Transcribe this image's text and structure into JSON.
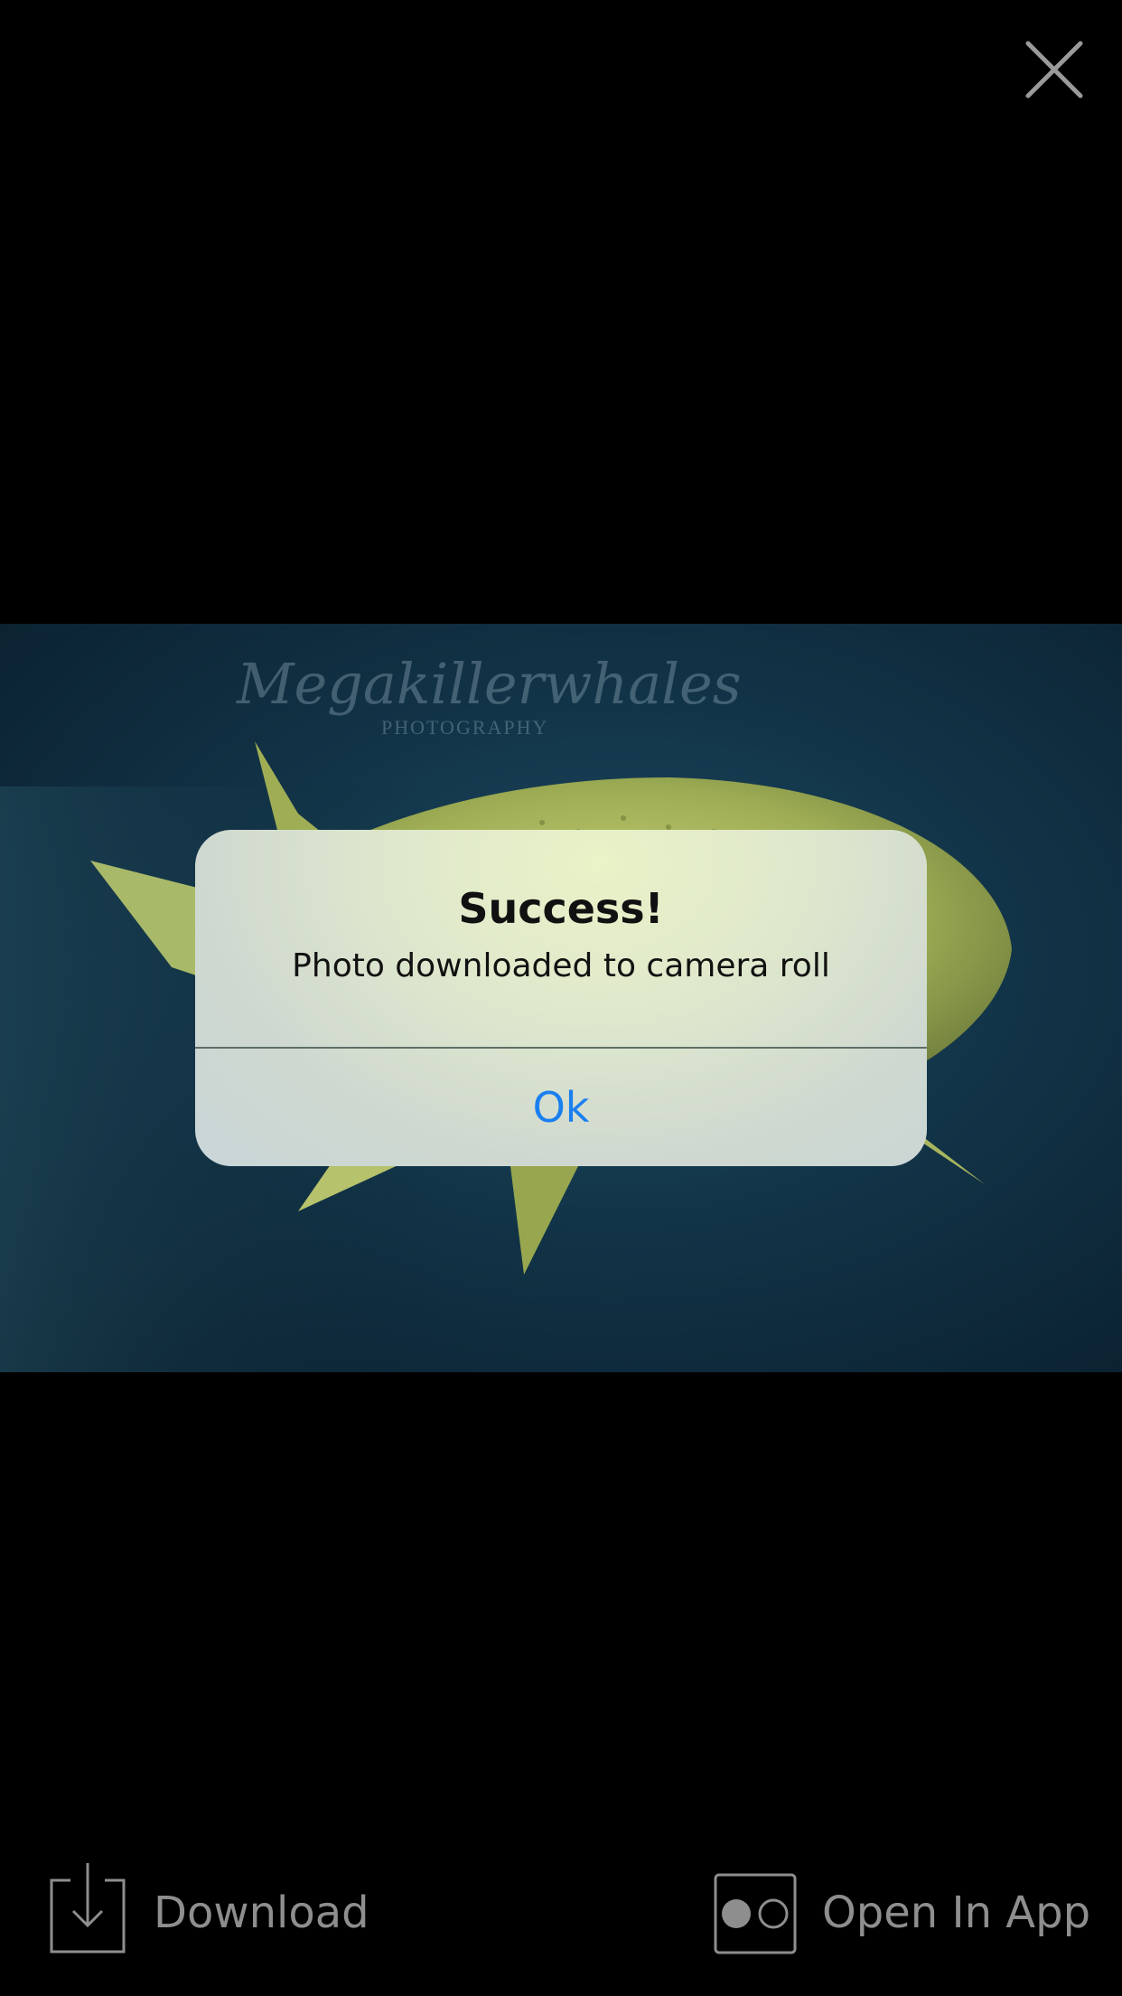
{
  "viewer": {
    "close_icon": "close-icon",
    "photo_watermark_script": "Megakillerwhales",
    "photo_watermark_sub": "PHOTOGRAPHY"
  },
  "alert": {
    "title": "Success!",
    "message": "Photo downloaded to camera roll",
    "ok_label": "Ok",
    "ok_color": "#1a7ff0"
  },
  "toolbar": {
    "download_label": "Download",
    "download_icon": "download-icon",
    "open_in_app_label": "Open In App",
    "open_in_app_icon": "flickr-icon"
  }
}
